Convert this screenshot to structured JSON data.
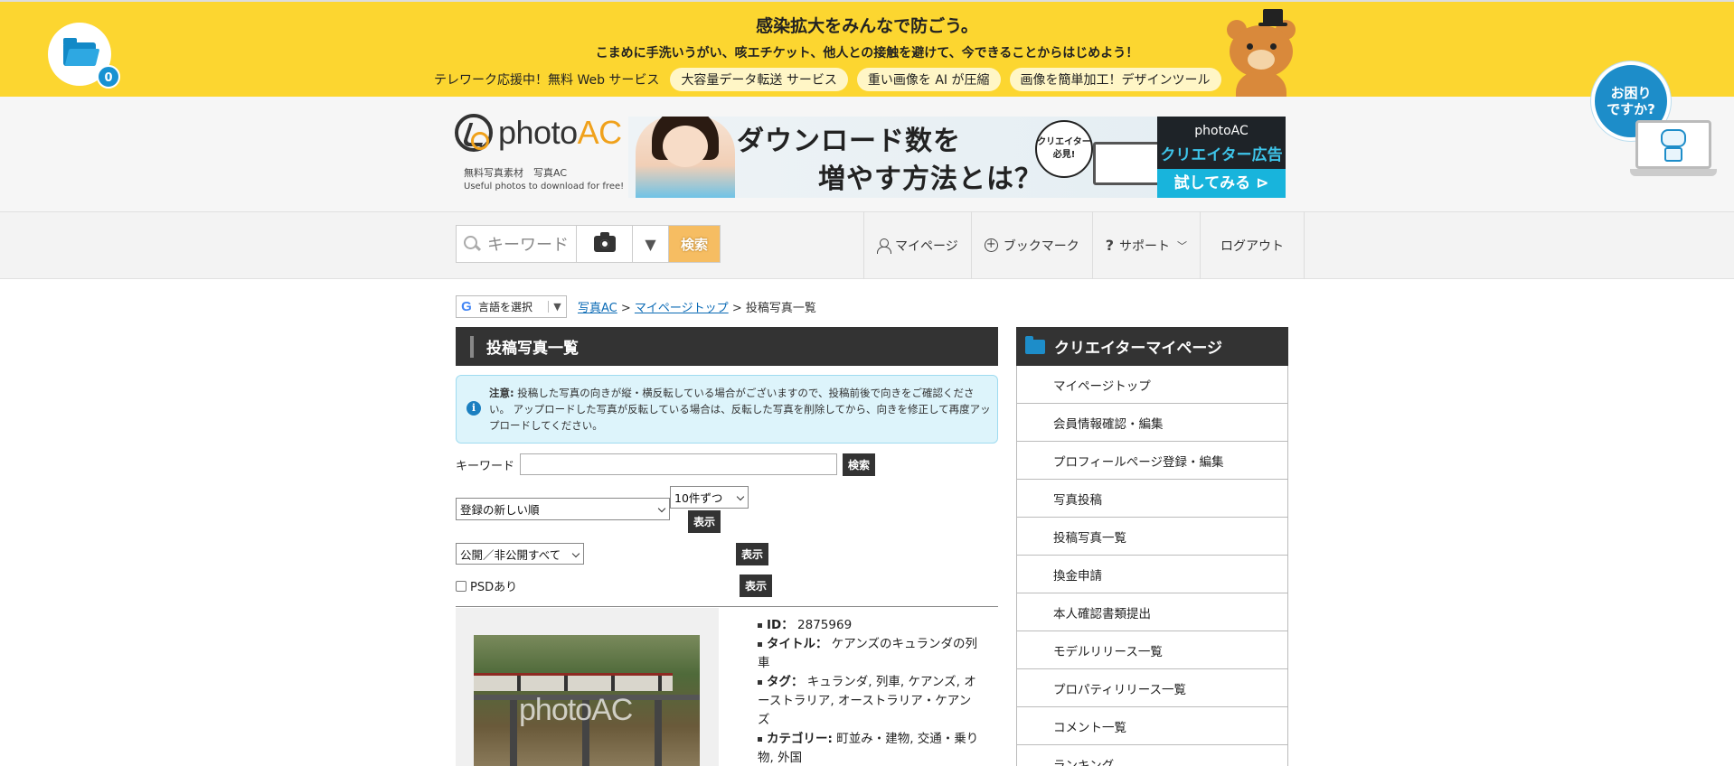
{
  "campaign": {
    "title": "感染拡大をみんなで防ごう。",
    "subtitle": "こまめに手洗いうがい、咳エチケット、他人との接触を避けて、今できることからはじめよう！",
    "lead": "テレワーク応援中！無料 Web サービス",
    "pills": [
      "大容量データ転送 サービス",
      "重い画像を AI が圧縮",
      "画像を簡単加工！デザインツール"
    ]
  },
  "folder_badge": "0",
  "help": {
    "line1": "お困り",
    "line2": "ですか?"
  },
  "logo": {
    "brand1": "photo",
    "brand2": "AC",
    "sub1": "無料写真素材　写真AC",
    "sub2": "Useful photos to download for free!"
  },
  "ad": {
    "headline1": "ダウンロード数を",
    "headline2": "増やす方法とは？",
    "badge1": "クリエイター",
    "badge2": "必見!",
    "brand": "photoAC",
    "cta1": "クリエイター広告",
    "cta2": "試してみる"
  },
  "search": {
    "placeholder": "キーワード",
    "button": "検索"
  },
  "nav": {
    "mypage": "マイページ",
    "bookmark": "ブックマーク",
    "support": "サポート",
    "logout": "ログアウト"
  },
  "lang": {
    "label": "言語を選択"
  },
  "breadcrumb": {
    "home": "写真AC",
    "mypage": "マイページトップ",
    "current": "投稿写真一覧"
  },
  "main": {
    "title": "投稿写真一覧",
    "notice_label": "注意:",
    "notice_text": "投稿した写真の向きが縦・横反転している場合がございますので、投稿前後で向きをご確認ください。 アップロードした写真が反転している場合は、反転した写真を削除してから、向きを修正して再度アップロードしてください。",
    "keyword_label": "キーワード",
    "keyword_value": "",
    "search_button": "検索",
    "sort_value": "登録の新しい順",
    "per_page_value": "10件ずつ",
    "show_button": "表示",
    "visibility_value": "公開／非公開すべて",
    "psd_label": "PSDあり",
    "photo_watermark": "photoAC",
    "meta": {
      "id_label": "ID：",
      "id_value": "2875969",
      "title_label": "タイトル：",
      "title_value": "ケアンズのキュランダの列車",
      "tag_label": "タグ：",
      "tag_value": "キュランダ, 列車, ケアンズ, オーストラリア, オーストラリア・ケアンズ",
      "category_label": "カテゴリー:",
      "category_value": "町並み・建物, 交通・乗り物, 外国"
    }
  },
  "sidebar": {
    "title": "クリエイターマイページ",
    "items": [
      "マイページトップ",
      "会員情報確認・編集",
      "プロフィールページ登録・編集",
      "写真投稿",
      "投稿写真一覧",
      "換金申請",
      "本人確認書類提出",
      "モデルリリース一覧",
      "プロパティリリース一覧",
      "コメント一覧",
      "ランキング"
    ]
  },
  "colors": {
    "campaign_yellow": "#fcd630",
    "accent_blue": "#1d8dc9",
    "search_orange": "#f6bd62",
    "dark_header": "#333333"
  }
}
